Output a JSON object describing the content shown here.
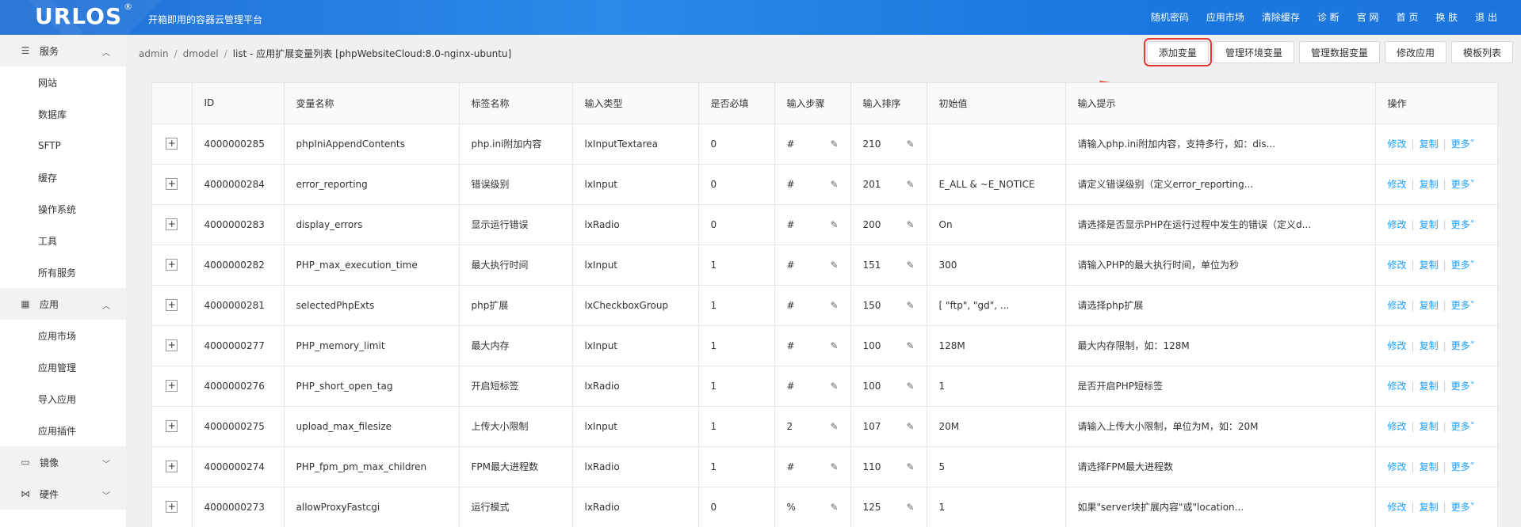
{
  "header": {
    "logo": "URLOS",
    "logo_mark": "®",
    "slogan": "开箱即用的容器云管理平台",
    "nav": [
      "随机密码",
      "应用市场",
      "清除缓存",
      "诊 断",
      "官 网",
      "首 页",
      "换 肤",
      "退 出"
    ]
  },
  "sidebar": {
    "groups": [
      {
        "label": "服务",
        "icon": "server-icon",
        "expanded": true,
        "items": [
          "网站",
          "数据库",
          "SFTP",
          "缓存",
          "操作系统",
          "工具",
          "所有服务"
        ]
      },
      {
        "label": "应用",
        "icon": "apps-grid-icon",
        "expanded": true,
        "items": [
          "应用市场",
          "应用管理",
          "导入应用",
          "应用插件"
        ]
      },
      {
        "label": "镜像",
        "icon": "disk-icon",
        "expanded": false,
        "items": []
      },
      {
        "label": "硬件",
        "icon": "share-nodes-icon",
        "expanded": false,
        "items": []
      }
    ]
  },
  "breadcrumb": {
    "items": [
      "admin",
      "dmodel"
    ],
    "current": "list  -  应用扩展变量列表 [phpWebsiteCloud:8.0-nginx-ubuntu]"
  },
  "actions": [
    "添加变量",
    "管理环境变量",
    "管理数据变量",
    "修改应用",
    "模板列表"
  ],
  "table": {
    "columns": [
      "",
      "ID",
      "变量名称",
      "标签名称",
      "输入类型",
      "是否必填",
      "输入步骤",
      "输入排序",
      "初始值",
      "输入提示",
      "操作"
    ],
    "op_labels": {
      "edit": "修改",
      "copy": "复制",
      "more": "更多"
    },
    "rows": [
      {
        "id": "4000000285",
        "name": "phpIniAppendContents",
        "label": "php.ini附加内容",
        "type": "lxInputTextarea",
        "required": "0",
        "step": "#",
        "order": "210",
        "init": "",
        "hint": "请输入php.ini附加内容，支持多行，如：dis..."
      },
      {
        "id": "4000000284",
        "name": "error_reporting",
        "label": "错误级别",
        "type": "lxInput",
        "required": "0",
        "step": "#",
        "order": "201",
        "init": "E_ALL & ~E_NOTICE",
        "hint": "请定义错误级别（定义error_reporting..."
      },
      {
        "id": "4000000283",
        "name": "display_errors",
        "label": "显示运行错误",
        "type": "lxRadio",
        "required": "0",
        "step": "#",
        "order": "200",
        "init": "On",
        "hint": "请选择是否显示PHP在运行过程中发生的错误（定义d..."
      },
      {
        "id": "4000000282",
        "name": "PHP_max_execution_time",
        "label": "最大执行时间",
        "type": "lxInput",
        "required": "1",
        "step": "#",
        "order": "151",
        "init": "300",
        "hint": "请输入PHP的最大执行时间，单位为秒"
      },
      {
        "id": "4000000281",
        "name": "selectedPhpExts",
        "label": "php扩展",
        "type": "lxCheckboxGroup",
        "required": "1",
        "step": "#",
        "order": "150",
        "init": "[ \"ftp\", \"gd\", ...",
        "hint": "请选择php扩展"
      },
      {
        "id": "4000000277",
        "name": "PHP_memory_limit",
        "label": "最大内存",
        "type": "lxInput",
        "required": "1",
        "step": "#",
        "order": "100",
        "init": "128M",
        "hint": "最大内存限制，如：128M"
      },
      {
        "id": "4000000276",
        "name": "PHP_short_open_tag",
        "label": "开启短标签",
        "type": "lxRadio",
        "required": "1",
        "step": "#",
        "order": "100",
        "init": "1",
        "hint": "是否开启PHP短标签"
      },
      {
        "id": "4000000275",
        "name": "upload_max_filesize",
        "label": "上传大小限制",
        "type": "lxInput",
        "required": "1",
        "step": "2",
        "order": "107",
        "init": "20M",
        "hint": "请输入上传大小限制，单位为M，如：20M"
      },
      {
        "id": "4000000274",
        "name": "PHP_fpm_pm_max_children",
        "label": "FPM最大进程数",
        "type": "lxRadio",
        "required": "1",
        "step": "#",
        "order": "110",
        "init": "5",
        "hint": "请选择FPM最大进程数"
      },
      {
        "id": "4000000273",
        "name": "allowProxyFastcgi",
        "label": "运行模式",
        "type": "lxRadio",
        "required": "0",
        "step": "%",
        "order": "125",
        "init": "1",
        "hint": "如果\"server块扩展内容\"或\"location..."
      }
    ]
  },
  "colors": {
    "header": "#1f78e0",
    "link": "#1e9fff",
    "highlight": "#e53935"
  }
}
